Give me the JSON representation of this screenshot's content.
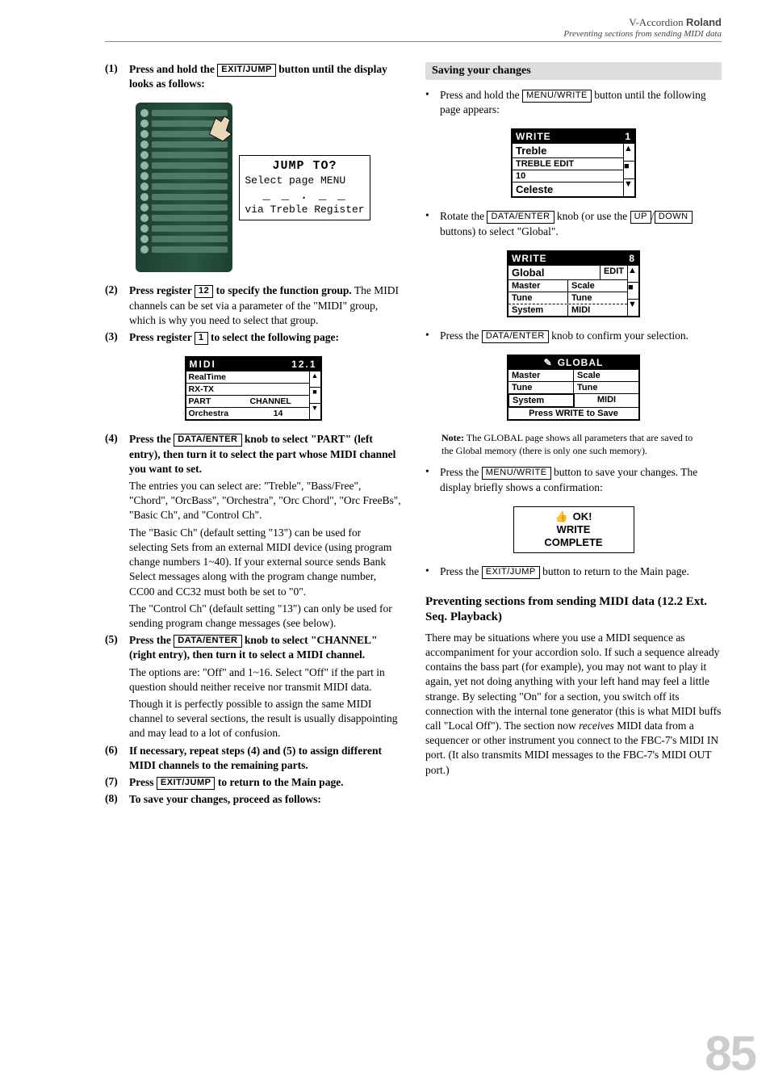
{
  "header": {
    "product": "V-Accordion",
    "brand": "Roland",
    "subtitle": "Preventing sections from sending MIDI data"
  },
  "steps": {
    "s1": {
      "num": "(1)",
      "text_a": "Press and hold the ",
      "key": "EXIT/JUMP",
      "text_b": " button until the display looks as follows:"
    },
    "s2": {
      "num": "(2)",
      "bold_a": "Press register ",
      "key": "12",
      "bold_b": " to specify the function group.",
      "plain": "The MIDI channels can be set via a parameter of the \"MIDI\" group, which is why you need to select that group."
    },
    "s3": {
      "num": "(3)",
      "bold_a": "Press register ",
      "key": "1",
      "bold_b": " to select the following page:"
    },
    "s4": {
      "num": "(4)",
      "bold_a": "Press the ",
      "key": "DATA/ENTER",
      "bold_b": " knob to select \"PART\" (left entry), then turn it to select the part whose MIDI channel you want to set.",
      "p1": "The entries you can select are: \"Treble\", \"Bass/Free\", \"Chord\", \"OrcBass\", \"Orchestra\", \"Orc Chord\", \"Orc FreeBs\", \"Basic Ch\", and \"Control Ch\".",
      "p2": "The \"Basic Ch\" (default setting \"13\") can be used for selecting Sets from an external MIDI device (using program change numbers 1~40). If your external source sends Bank Select messages along with the program change number, CC00 and CC32 must both be set to \"0\".",
      "p3": "The \"Control Ch\" (default setting \"13\") can only be used for sending program change messages (see below)."
    },
    "s5": {
      "num": "(5)",
      "bold_a": "Press the ",
      "key": "DATA/ENTER",
      "bold_b": " knob to select \"CHANNEL\" (right entry), then turn it to select a MIDI channel.",
      "p1": "The options are: \"Off\" and 1~16. Select \"Off\" if the part in question should neither receive nor transmit MIDI data.",
      "p2": "Though it is perfectly possible to assign the same MIDI channel to several sections, the result is usually disappointing and may lead to a lot of confusion."
    },
    "s6": {
      "num": "(6)",
      "bold": "If necessary, repeat steps (4) and (5) to assign different MIDI channels to the remaining parts."
    },
    "s7": {
      "num": "(7)",
      "bold_a": "Press ",
      "key": "EXIT/JUMP",
      "bold_b": " to return to the Main page."
    },
    "s8": {
      "num": "(8)",
      "bold": "To save your changes, proceed as follows:"
    }
  },
  "lcd_jump": {
    "title": "JUMP TO?",
    "l2": "Select page MENU",
    "l3": "_ _ . _ _",
    "l4": "via Treble Register"
  },
  "midi_screen": {
    "title": "MIDI",
    "num": "12.1",
    "r1a": "RealTime",
    "r1b": "",
    "r2a": "RX-TX",
    "r3a": "PART",
    "r3b": "CHANNEL",
    "r4a": "Orchestra",
    "r4b": "14"
  },
  "right": {
    "subhead": "Saving your changes",
    "b1": {
      "text_a": "Press and hold the ",
      "key": "MENU/WRITE",
      "text_b": " button until the following page appears:"
    },
    "write1": {
      "title": "WRITE",
      "num": "1",
      "l1": "Treble",
      "l2": "TREBLE EDIT",
      "l3": "10",
      "l4": "Celeste"
    },
    "b2": {
      "text_a": "Rotate the ",
      "key1": "DATA/ENTER",
      "text_b": " knob (or use the ",
      "key2": "UP",
      "text_c": "/",
      "key3": "DOWN",
      "text_d": " buttons) to select \"Global\"."
    },
    "write2": {
      "title": "WRITE",
      "num": "8",
      "l1": "Global",
      "l1b": "EDIT",
      "l2a": "Master",
      "l2b": "Scale",
      "l3a": "Tune",
      "l3b": "Tune",
      "l4a": "System",
      "l4b": "MIDI"
    },
    "b3": {
      "text_a": "Press the ",
      "key": "DATA/ENTER",
      "text_b": " knob to confirm your selection."
    },
    "global": {
      "title": "GLOBAL",
      "r1a": "Master",
      "r1b": "Scale",
      "r2a": "Tune",
      "r2b": "Tune",
      "r3a": "System",
      "r3b": "MIDI",
      "foot": "Press WRITE to Save"
    },
    "note": {
      "label": "Note:",
      "text": " The GLOBAL page shows all parameters that are saved to the Global memory (there is only one such memory)."
    },
    "b4": {
      "text_a": "Press the ",
      "key": "MENU/WRITE",
      "text_b": " button to save your changes. The display briefly shows a confirmation:"
    },
    "ok": {
      "l1": "OK!",
      "l2": "WRITE",
      "l3": "COMPLETE"
    },
    "b5": {
      "text_a": "Press the ",
      "key": "EXIT/JUMP",
      "text_b": " button to return to the Main page."
    },
    "section_head": "Preventing sections from sending MIDI data (12.2 Ext. Seq. Playback)",
    "section_body_a": "There may be situations where you use a MIDI sequence as accompaniment for your accordion solo. If such a sequence already contains the bass part (for example), you may not want to play it again, yet not doing anything with your left hand may feel a little strange. By selecting \"On\" for a section, you switch off its connection with the internal tone generator (this is what MIDI buffs call \"Local Off\"). The section now ",
    "section_body_italic": "receives",
    "section_body_b": " MIDI data from a sequencer or other instrument you connect to the FBC-7's MIDI IN port. (It also transmits MIDI messages to the FBC-7's MIDI OUT port.)"
  },
  "page": "85"
}
